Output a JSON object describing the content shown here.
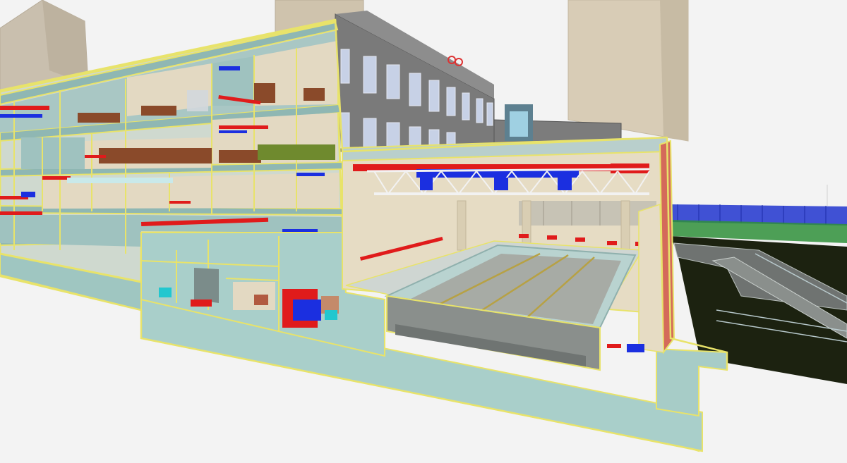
{
  "viewport": {
    "background": "#f3f3f3"
  },
  "palette": {
    "wall_outline": "#e8e36a",
    "slab_glass": "#9fc6c1",
    "slab_edge": "#5f8f8c",
    "facade_grey": "#7a7a7a",
    "tower_beige": "#d8ccb6",
    "interior_cream": "#e6dcc4",
    "pool_floor": "#a7aba5",
    "pool_water": "#b9d3d0",
    "duct_red": "#e01b1b",
    "duct_blue": "#1b2fe0",
    "truss_white": "#f2f2f2",
    "furniture_brown": "#8a4a2a",
    "ground_dark": "#1c2210",
    "fence_blue": "#2c3fd0",
    "fence_green": "#2f8f3a",
    "cyan_box": "#22c7cf"
  }
}
